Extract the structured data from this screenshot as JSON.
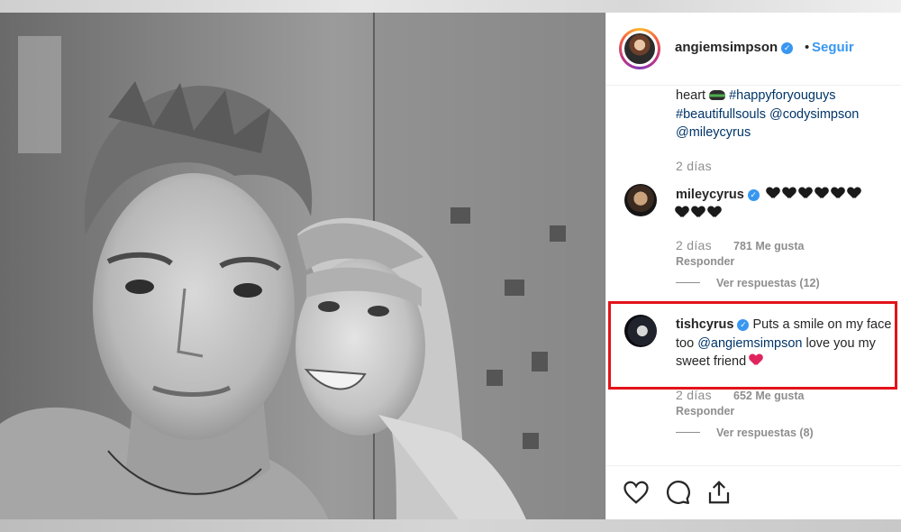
{
  "post": {
    "username": "angiemsimpson",
    "dot": "•",
    "follow_label": "Seguir",
    "caption": {
      "line1_text": "heart",
      "line1_tag": "#happyforyouguys",
      "line2_tag": "#beautifullsouls",
      "line2_mention": "@codysimpson",
      "line3_mention": "@mileycyrus"
    },
    "time": "2 días"
  },
  "comments": [
    {
      "username": "mileycyrus",
      "text": "🖤🖤🖤🖤🖤🖤🖤🖤🖤",
      "hearts": 9,
      "time": "2 días",
      "likes": "781 Me gusta",
      "reply_label": "Responder",
      "view_replies": "Ver respuestas (12)"
    },
    {
      "username": "tishcyrus",
      "text_start": "Puts a smile on my face too",
      "mention": "@angiemsimpson",
      "text_end": "love you my sweet friend",
      "time": "2 días",
      "likes": "652 Me gusta",
      "reply_label": "Responder",
      "view_replies": "Ver respuestas (8)"
    }
  ],
  "icons": {
    "like": "heart-outline-icon",
    "comment": "speech-bubble-icon",
    "share": "share-icon",
    "verified": "verified-badge-icon"
  },
  "colors": {
    "accent": "#3897f0",
    "highlight": "#e4121a",
    "mention": "#003569",
    "muted": "#8e8e8e"
  }
}
